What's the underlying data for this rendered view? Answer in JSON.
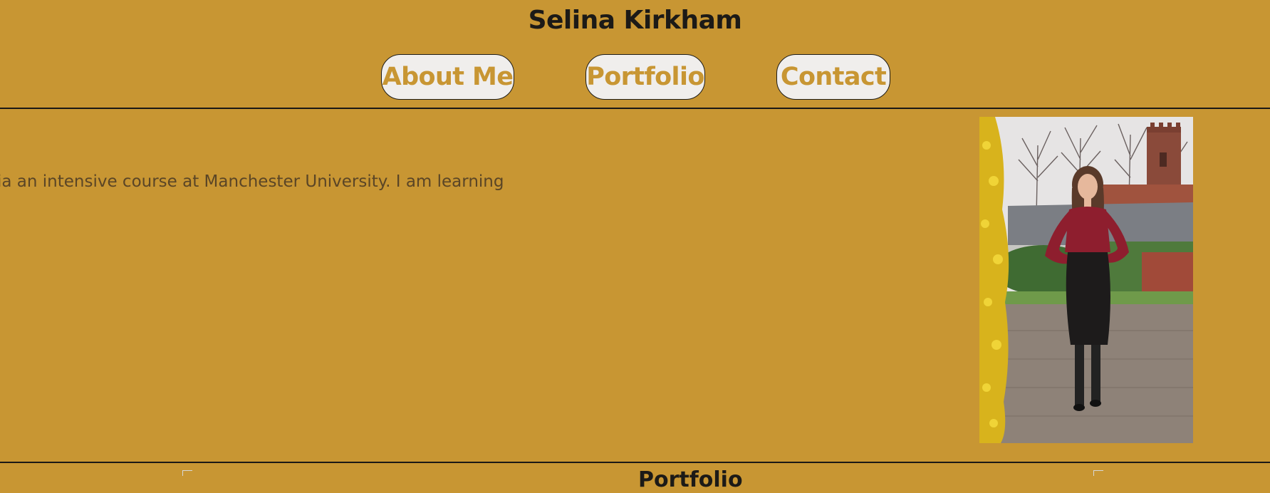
{
  "header": {
    "title": "Selina Kirkham"
  },
  "nav": {
    "about_label": "About Me",
    "portfolio_label": "Portfolio",
    "contact_label": "Contact"
  },
  "about": {
    "text": "ia an intensive course at Manchester University. I am learning",
    "photo_icon": "profile-photo"
  },
  "portfolio": {
    "heading": "Portfolio"
  },
  "colors": {
    "background": "#c89633",
    "button_bg": "#f0eeec",
    "button_text": "#c89633",
    "title_text": "#1c1a17",
    "body_text": "#5a4526"
  }
}
